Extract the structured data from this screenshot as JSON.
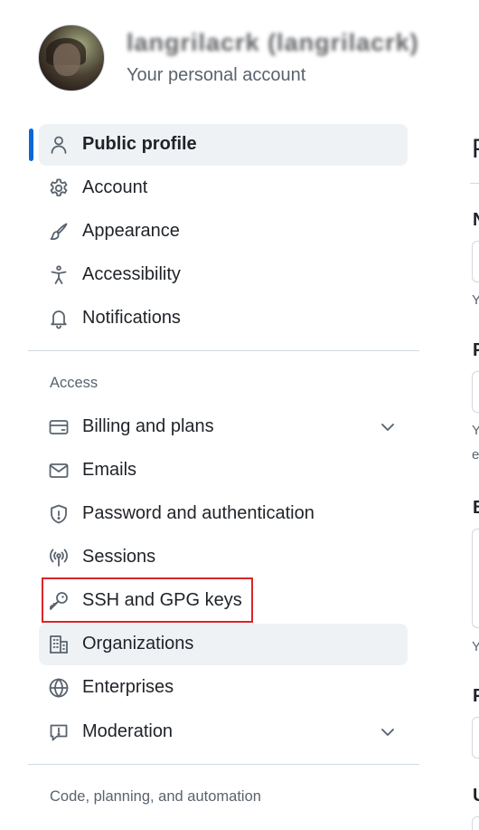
{
  "header": {
    "username": "langrilacrk (langrilacrk)",
    "subtitle": "Your personal account"
  },
  "nav": {
    "items": [
      {
        "label": "Public profile",
        "icon": "person-icon"
      },
      {
        "label": "Account",
        "icon": "gear-icon"
      },
      {
        "label": "Appearance",
        "icon": "paintbrush-icon"
      },
      {
        "label": "Accessibility",
        "icon": "accessibility-icon"
      },
      {
        "label": "Notifications",
        "icon": "bell-icon"
      }
    ],
    "access_heading": "Access",
    "access_items": [
      {
        "label": "Billing and plans",
        "icon": "credit-card-icon"
      },
      {
        "label": "Emails",
        "icon": "mail-icon"
      },
      {
        "label": "Password and authentication",
        "icon": "shield-lock-icon"
      },
      {
        "label": "Sessions",
        "icon": "broadcast-icon"
      },
      {
        "label": "SSH and GPG keys",
        "icon": "key-icon"
      },
      {
        "label": "Organizations",
        "icon": "organization-icon"
      },
      {
        "label": "Enterprises",
        "icon": "globe-icon"
      },
      {
        "label": "Moderation",
        "icon": "report-icon"
      }
    ],
    "code_heading": "Code, planning, and automation"
  },
  "right": {
    "title": "P",
    "labels": [
      "N",
      "P",
      "B",
      "P",
      "U"
    ],
    "notes": [
      "Y",
      "Y",
      "e",
      "Y"
    ]
  },
  "colors": {
    "accent": "#0969da",
    "highlight": "#d9252a",
    "selected_bg": "#eff2f5"
  }
}
